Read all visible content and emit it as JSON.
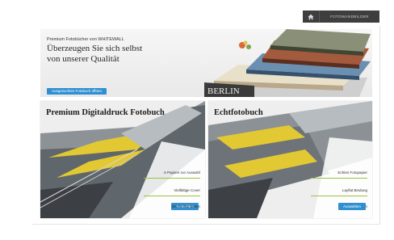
{
  "topbar": {
    "home_icon": "home-icon",
    "label": "FOTOWANDBILDER"
  },
  "hero": {
    "kicker": "Premium Fotobücher von WHITEWALL",
    "headline_line1": "Überzeugen Sie sich selbst",
    "headline_line2": "von unserer Qualität",
    "cta": "Ausgesuchtes Fotobuch öffnen",
    "book_spine_text": "BERLIN"
  },
  "cards": [
    {
      "title": "Premium Digitaldruck Fotobuch",
      "features": [
        "6 Papiere zur Auswahl",
        "Vielfältige Cover",
        "Bis zu 252 Seiten"
      ],
      "button": "Auswählen"
    },
    {
      "title": "Echtfotobuch",
      "features": [
        "Echtes Fotopapier",
        "Layflat Bindung",
        "Bis zu 72 Seiten"
      ],
      "button": "Auswählen"
    }
  ],
  "colors": {
    "accent": "#2f8fd1",
    "rule": "#9bc13c",
    "topbar": "#3e3e3e"
  }
}
